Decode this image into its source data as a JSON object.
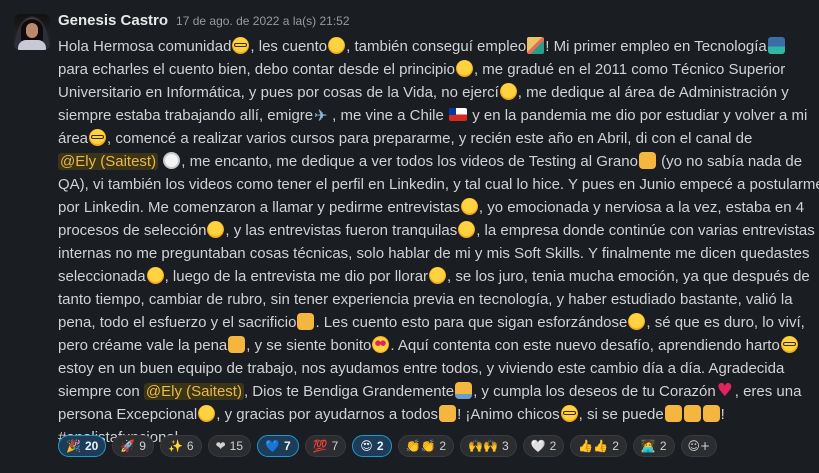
{
  "message": {
    "author": "Genesis Castro",
    "timestamp": "17 de ago. de 2022 a la(s) 21:52",
    "lines": [
      [
        {
          "t": "Hola Hermosa comunidad"
        },
        {
          "e": "face glasses"
        },
        {
          "t": ", les cuento"
        },
        {
          "e": "face"
        },
        {
          "t": ", también conseguí empleo"
        },
        {
          "e": "party"
        },
        {
          "t": "! Mi primer empleo en Tecnología"
        },
        {
          "e": "tech"
        }
      ],
      [
        {
          "t": "para echarles el cuento bien, debo contar desde el principio"
        },
        {
          "e": "face"
        },
        {
          "t": ", me gradué en el 2011 como Técnico Superior"
        }
      ],
      [
        {
          "t": "Universitario en Informática, y pues por cosas de la Vida, no ejercí"
        },
        {
          "e": "face"
        },
        {
          "t": ", me dedique al área de Administración y"
        }
      ],
      [
        {
          "t": "siempre estaba trabajando allí, emigre"
        },
        {
          "e": "plane"
        },
        {
          "t": ", me vine a Chile "
        },
        {
          "e": "flag-cl"
        },
        {
          "t": " y en la pandemia me dio por estudiar y volver a mi"
        }
      ],
      [
        {
          "t": "área"
        },
        {
          "e": "face glasses"
        },
        {
          "t": ", comencé a realizar varios cursos para prepararme, y recién este año en Abril, di con el canal de"
        }
      ],
      [
        {
          "m": "@Ely (Saitest)"
        },
        {
          "t": " "
        },
        {
          "e": "astro"
        },
        {
          "t": ", me encanto, me dedique a ver todos los videos de Testing al Grano"
        },
        {
          "e": "hand"
        },
        {
          "t": " (yo no sabía nada de"
        }
      ],
      [
        {
          "t": "QA), vi también los videos como tener el perfil en Linkedin, y tal cual lo hice. Y pues en Junio empecé a postularme"
        }
      ],
      [
        {
          "t": "por Linkedin. Me comenzaron a llamar y pedirme entrevistas"
        },
        {
          "e": "face"
        },
        {
          "t": ", yo emocionada y nerviosa a la vez, estaba en 4"
        }
      ],
      [
        {
          "t": "procesos de selección"
        },
        {
          "e": "face"
        },
        {
          "t": ", y las entrevistas fueron tranquilas"
        },
        {
          "e": "face"
        },
        {
          "t": ", la empresa donde continúe con varias entrevistas"
        }
      ],
      [
        {
          "t": "internas no me preguntaban cosas técnicas, solo hablar de mi y mis Soft Skills. Y finalmente me dicen quedastes"
        }
      ],
      [
        {
          "t": "seleccionada"
        },
        {
          "e": "face"
        },
        {
          "t": ", luego de la entrevista me dio por llorar"
        },
        {
          "e": "face"
        },
        {
          "t": ", se los juro, tenia mucha emoción, ya que después de"
        }
      ],
      [
        {
          "t": "tanto tiempo, cambiar de rubro, sin tener experiencia previa en tecnología, y haber estudiado bastante, valió la"
        }
      ],
      [
        {
          "t": "pena, todo el esfuerzo y el sacrificio"
        },
        {
          "e": "hand"
        },
        {
          "t": ". Les cuento esto para que sigan esforzándose"
        },
        {
          "e": "face"
        },
        {
          "t": ", sé que es duro, lo viví,"
        }
      ],
      [
        {
          "t": "pero créame vale la pena"
        },
        {
          "e": "muscle"
        },
        {
          "t": ", y se siente bonito"
        },
        {
          "e": "loveeyes"
        },
        {
          "t": ". Aquí contenta con este nuevo desafío, aprendiendo harto"
        },
        {
          "e": "face glasses"
        }
      ],
      [
        {
          "t": "estoy en un buen equipo de trabajo, nos ayudamos entre todos, y viviendo este cambio día a día. Agradecida"
        }
      ],
      [
        {
          "t": "siempre con "
        },
        {
          "m": "@Ely (Saitest)"
        },
        {
          "t": ", Dios te Bendiga Grandemente"
        },
        {
          "e": "pray"
        },
        {
          "t": ", y cumpla los deseos de tu Corazón"
        },
        {
          "e": "heart"
        },
        {
          "t": ", eres una"
        }
      ],
      [
        {
          "t": "persona Excepcional"
        },
        {
          "e": "face"
        },
        {
          "t": ", y gracias por ayudarnos a todos"
        },
        {
          "e": "hand"
        },
        {
          "t": "! ¡Animo chicos"
        },
        {
          "e": "face glasses"
        },
        {
          "t": ", si se puede"
        },
        {
          "e": "hand"
        },
        {
          "e": "hand"
        },
        {
          "e": "hand"
        },
        {
          "t": "!"
        }
      ],
      [
        {
          "t": "#analistafuncional"
        }
      ]
    ]
  },
  "reactions": [
    {
      "icon": "🎉",
      "icon_name": "party-popper-icon",
      "count": "20",
      "active": true
    },
    {
      "icon": "🚀",
      "icon_name": "rocket-icon",
      "count": "9",
      "active": false
    },
    {
      "icon": "✨",
      "icon_name": "sparkles-icon",
      "count": "6",
      "active": false
    },
    {
      "icon": "❤",
      "icon_name": "red-heart-icon",
      "count": "15",
      "active": false
    },
    {
      "icon": "💙",
      "icon_name": "blue-heart-icon",
      "count": "7",
      "active": true
    },
    {
      "icon": "💯",
      "icon_name": "hundred-points-icon",
      "count": "7",
      "active": false
    },
    {
      "icon": "😍",
      "icon_name": "heart-eyes-icon",
      "count": "2",
      "active": true
    },
    {
      "icon": "👏👏",
      "icon_name": "clapping-hands-icon",
      "count": "2",
      "active": false
    },
    {
      "icon": "🙌🙌",
      "icon_name": "raising-hands-icon",
      "count": "3",
      "active": false
    },
    {
      "icon": "🤍",
      "icon_name": "white-heart-icon",
      "count": "2",
      "active": false
    },
    {
      "icon": "👍👍",
      "icon_name": "thumbs-up-icon",
      "count": "2",
      "active": false
    },
    {
      "icon": "🧑‍💻",
      "icon_name": "technologist-icon",
      "count": "2",
      "active": false
    }
  ],
  "add_reaction_icon": "☺+"
}
